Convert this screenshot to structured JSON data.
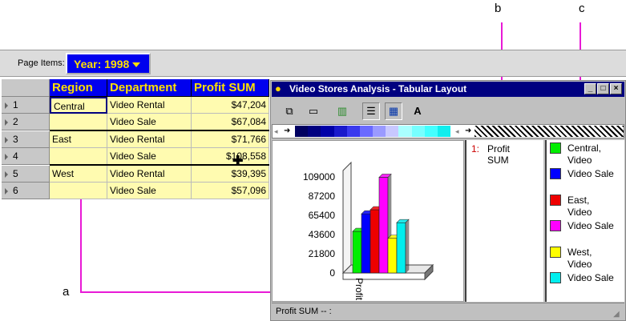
{
  "callouts": {
    "a": "a",
    "b": "b",
    "c": "c"
  },
  "page_items": {
    "label": "Page Items:",
    "selector": "Year: 1998"
  },
  "grid": {
    "headers": [
      "Region",
      "Department",
      "Profit SUM"
    ],
    "rows": [
      {
        "num": "1",
        "region": "Central",
        "dept": "Video Rental",
        "profit": "$47,204"
      },
      {
        "num": "2",
        "region": "",
        "dept": "Video Sale",
        "profit": "$67,084"
      },
      {
        "num": "3",
        "region": "East",
        "dept": "Video Rental",
        "profit": "$71,766"
      },
      {
        "num": "4",
        "region": "",
        "dept": "Video Sale",
        "profit": "$108,558"
      },
      {
        "num": "5",
        "region": "West",
        "dept": "Video Rental",
        "profit": "$39,395"
      },
      {
        "num": "6",
        "region": "",
        "dept": "Video Sale",
        "profit": "$57,096"
      }
    ]
  },
  "window": {
    "title": "Video Stores Analysis - Tabular Layout",
    "status": "Profit SUM -- :",
    "series_list": {
      "index": "1:",
      "name_line1": "Profit",
      "name_line2": "SUM"
    },
    "legend": [
      {
        "line1": "Central,",
        "line2": "Video",
        "color": "#00ee00"
      },
      {
        "line1": "Video Sale",
        "line2": "",
        "color": "#0000ff"
      },
      {
        "line1": "East,",
        "line2": "Video",
        "color": "#ee0000"
      },
      {
        "line1": "Video Sale",
        "line2": "",
        "color": "#ff00ff"
      },
      {
        "line1": "West,",
        "line2": "Video",
        "color": "#ffff00"
      },
      {
        "line1": "Video Sale",
        "line2": "",
        "color": "#00eeee"
      }
    ]
  },
  "chart_data": {
    "type": "bar",
    "categories": [
      "Profit SUM"
    ],
    "series": [
      {
        "name": "Central, Video Rental",
        "values": [
          47204
        ],
        "color": "#00ee00"
      },
      {
        "name": "Central, Video Sale",
        "values": [
          67084
        ],
        "color": "#0000ff"
      },
      {
        "name": "East, Video Rental",
        "values": [
          71766
        ],
        "color": "#ee0000"
      },
      {
        "name": "East, Video Sale",
        "values": [
          108558
        ],
        "color": "#ff00ff"
      },
      {
        "name": "West, Video Rental",
        "values": [
          39395
        ],
        "color": "#ffff00"
      },
      {
        "name": "West, Video Sale",
        "values": [
          57096
        ],
        "color": "#00eeee"
      }
    ],
    "yticks": [
      "109000",
      "87200",
      "65400",
      "43600",
      "21800",
      "0"
    ],
    "ylim": [
      0,
      109000
    ],
    "xlabel_text": "Profit SUM",
    "grid": false
  }
}
